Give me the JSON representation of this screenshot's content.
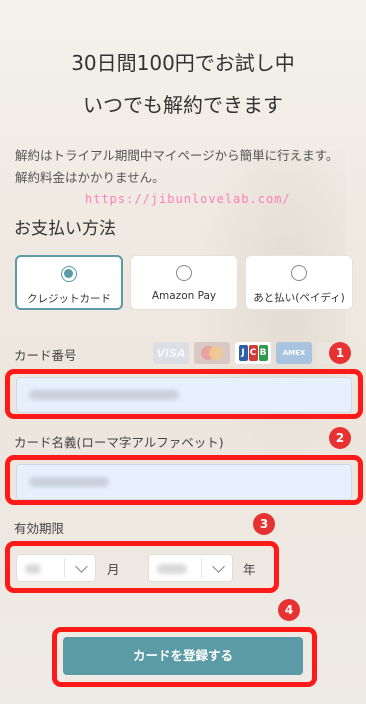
{
  "header": {
    "title_line1": "30日間100円でお試し中",
    "title_line2": "いつでも解約できます"
  },
  "description": {
    "line1": "解約はトライアル期間中マイページから簡単に行えます。",
    "line2": "解約料金はかかりません。"
  },
  "watermark": "https://jibunlovelab.com/",
  "payment": {
    "heading": "お支払い方法",
    "methods": [
      {
        "label": "クレジットカード",
        "selected": true
      },
      {
        "label": "Amazon Pay",
        "selected": false
      },
      {
        "label": "あと払い(ペイディ)",
        "selected": false
      }
    ]
  },
  "card_form": {
    "number_label": "カード番号",
    "name_label": "カード名義(ローマ字アルファベット)",
    "expiry_label": "有効期限",
    "month_unit": "月",
    "year_unit": "年",
    "submit_label": "カードを登録する",
    "brand_icons": [
      "visa-icon",
      "mastercard-icon",
      "jcb-icon",
      "amex-icon",
      "diners-icon"
    ],
    "brand_text": {
      "visa": "VISA",
      "jcb_j": "J",
      "jcb_c": "C",
      "jcb_b": "B",
      "amex": "AMEX"
    }
  },
  "annotations": {
    "badge1": "1",
    "badge2": "2",
    "badge3": "3",
    "badge4": "4"
  },
  "colors": {
    "accent": "#5a9ba6",
    "highlight": "#ff1a1a",
    "badge": "#e83232",
    "input_bg": "#e8f0fe"
  }
}
